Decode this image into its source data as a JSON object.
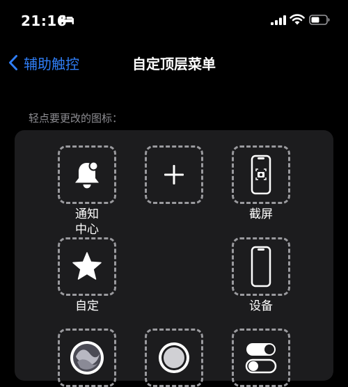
{
  "status_bar": {
    "time": "21:16",
    "icons": [
      "bed-icon",
      "signal-icon",
      "wifi-icon",
      "battery-icon"
    ]
  },
  "nav": {
    "back_label": "辅助触控",
    "title": "自定顶层菜单"
  },
  "section_label": "轻点要更改的图标：",
  "menu": {
    "slots": [
      {
        "icon": "notification-bell-icon",
        "label": "通知\n中心"
      },
      {
        "icon": "plus-icon",
        "label": ""
      },
      {
        "icon": "screenshot-icon",
        "label": "截屏"
      },
      {
        "icon": "star-icon",
        "label": "自定"
      },
      {
        "icon": "device-icon",
        "label": "设备"
      },
      {
        "icon": "siri-icon",
        "label": ""
      },
      {
        "icon": "home-button-icon",
        "label": ""
      },
      {
        "icon": "control-center-icon",
        "label": ""
      }
    ]
  },
  "colors": {
    "background": "#000000",
    "panel": "#1c1c1e",
    "accent_blue": "#2f7ef6",
    "section_label_gray": "#8d8d92",
    "slot_border": "#9a9a9e"
  }
}
